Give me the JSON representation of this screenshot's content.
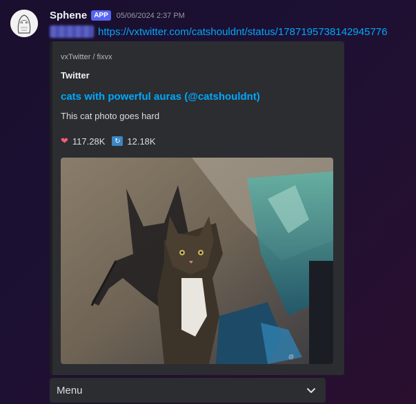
{
  "message": {
    "username": "Sphene",
    "app_badge": "APP",
    "timestamp": "05/06/2024 2:37 PM",
    "link": "https://vxtwitter.com/catshouldnt/status/1787195738142945776"
  },
  "embed": {
    "provider": "vxTwitter / fixvx",
    "author": "Twitter",
    "title": "cats with powerful auras (@catshouldnt)",
    "description": "This cat photo goes hard",
    "likes_icon": "heart-icon",
    "likes": "117.28K",
    "retweets_icon": "retweet-icon",
    "retweets": "12.18K",
    "image_icon": "cat-photo"
  },
  "menu": {
    "label": "Menu",
    "chevron_icon": "chevron-down-icon"
  },
  "colors": {
    "link": "#00a8fc",
    "app_badge": "#5865f2",
    "embed_bg": "#2b2d31"
  }
}
